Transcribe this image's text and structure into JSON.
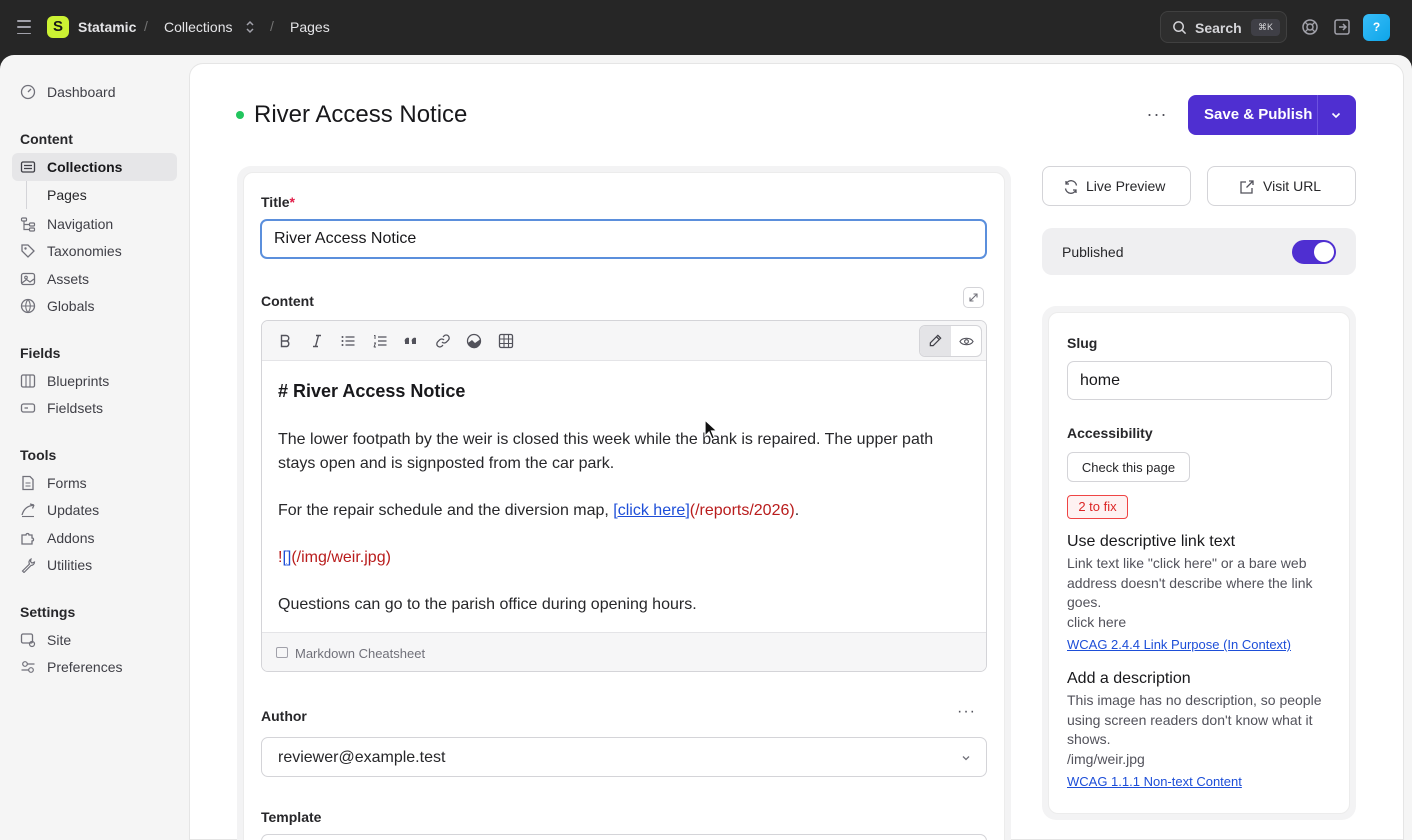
{
  "topbar": {
    "brand": "Statamic",
    "logo_letter": "S",
    "crumb_collections": "Collections",
    "crumb_pages": "Pages",
    "separator": "/",
    "search_label": "Search",
    "search_shortcut": "⌘K",
    "help_label": "?"
  },
  "sidebar": {
    "dashboard": "Dashboard",
    "content_heading": "Content",
    "collections": "Collections",
    "pages": "Pages",
    "navigation": "Navigation",
    "taxonomies": "Taxonomies",
    "assets": "Assets",
    "globals": "Globals",
    "fields_heading": "Fields",
    "blueprints": "Blueprints",
    "fieldsets": "Fieldsets",
    "tools_heading": "Tools",
    "forms": "Forms",
    "updates": "Updates",
    "addons": "Addons",
    "utilities": "Utilities",
    "settings_heading": "Settings",
    "site": "Site",
    "preferences": "Preferences"
  },
  "header": {
    "title": "River Access Notice",
    "more": "···",
    "publish_label": "Save & Publish"
  },
  "form": {
    "title_label": "Title",
    "required_mark": "*",
    "title_value": "River Access Notice",
    "content_label": "Content",
    "editor": {
      "heading": "# River Access Notice",
      "para1": "The lower footpath by the weir is closed this week while the bank is repaired. The upper path stays open and is signposted from the car park.",
      "para2_text": "For the repair schedule and the diversion map, ",
      "para2_link": "[click here]",
      "para2_url": "(/reports/2026)",
      "para2_end": ".",
      "image_bang": "!",
      "image_alt": "[]",
      "image_url": "(/img/weir.jpg)",
      "para4": "Questions can go to the parish office during opening hours.",
      "footer": "Markdown Cheatsheet"
    },
    "author_label": "Author",
    "author_more": "···",
    "author_value": "reviewer@example.test",
    "template_label": "Template"
  },
  "side": {
    "live_preview": "Live Preview",
    "visit_url": "Visit URL",
    "published_label": "Published",
    "published": true,
    "slug_label": "Slug",
    "slug_value": "home",
    "accessibility_label": "Accessibility",
    "check_button": "Check this page",
    "fix_badge": "2 to fix",
    "issues": [
      {
        "title": "Use descriptive link text",
        "body": "Link text like \"click here\" or a bare web address doesn't describe where the link goes.",
        "value": "click here",
        "link": "WCAG 2.4.4 Link Purpose (In Context)"
      },
      {
        "title": "Add a description",
        "body": "This image has no description, so people using screen readers don't know what it shows.",
        "value": "/img/weir.jpg",
        "link": "WCAG 1.1.1 Non-text Content"
      }
    ]
  },
  "colors": {
    "topbar_bg": "#262626",
    "brand_logo": "#ccf233",
    "primary": "#4f2fd1",
    "status_published": "#22c55e",
    "error": "#dc2626",
    "link": "#1d4ed8",
    "markdown_url": "#b91c1c"
  },
  "icons": {
    "menu": "hamburger-icon",
    "search": "search-icon",
    "support": "lifebuoy-icon",
    "logout": "log-out-icon",
    "live_preview": "refresh-icon",
    "visit_url": "external-link-icon"
  }
}
